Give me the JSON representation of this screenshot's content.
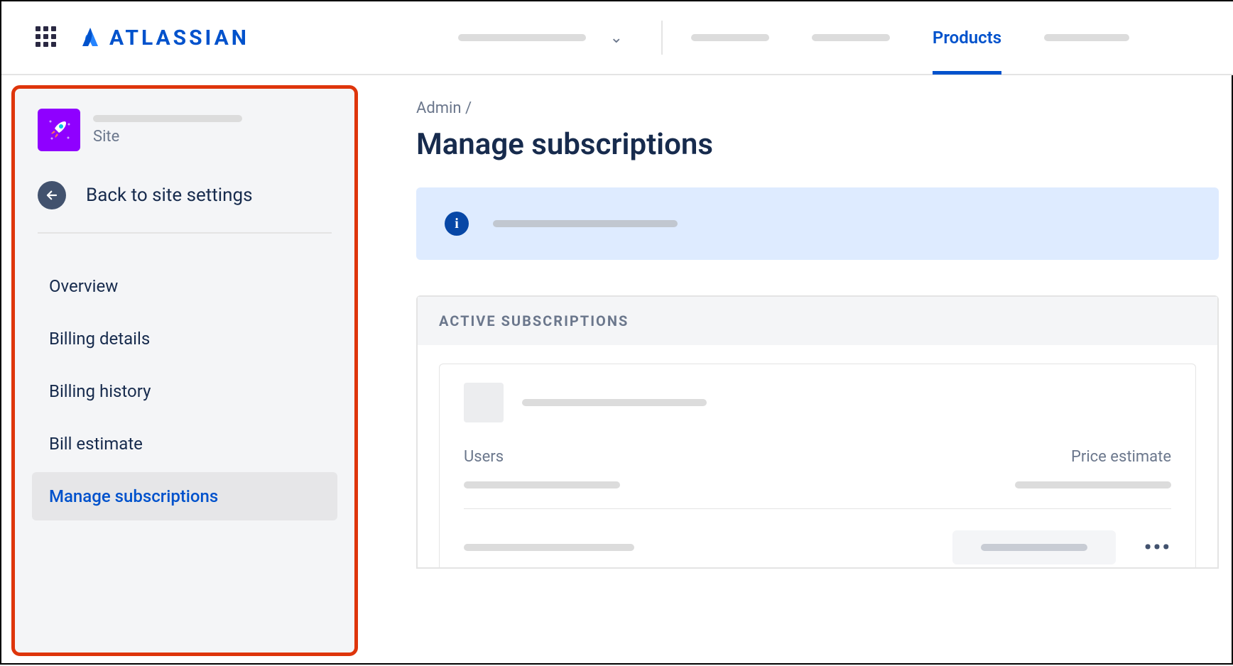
{
  "header": {
    "brand": "ATLASSIAN",
    "active_tab": "Products"
  },
  "sidebar": {
    "site_label": "Site",
    "back_label": "Back to site settings",
    "items": [
      {
        "label": "Overview"
      },
      {
        "label": "Billing details"
      },
      {
        "label": "Billing history"
      },
      {
        "label": "Bill estimate"
      },
      {
        "label": "Manage subscriptions"
      }
    ]
  },
  "main": {
    "breadcrumb": "Admin   /",
    "title": "Manage subscriptions",
    "section_heading": "ACTIVE SUBSCRIPTIONS",
    "col_users": "Users",
    "col_price": "Price estimate"
  }
}
